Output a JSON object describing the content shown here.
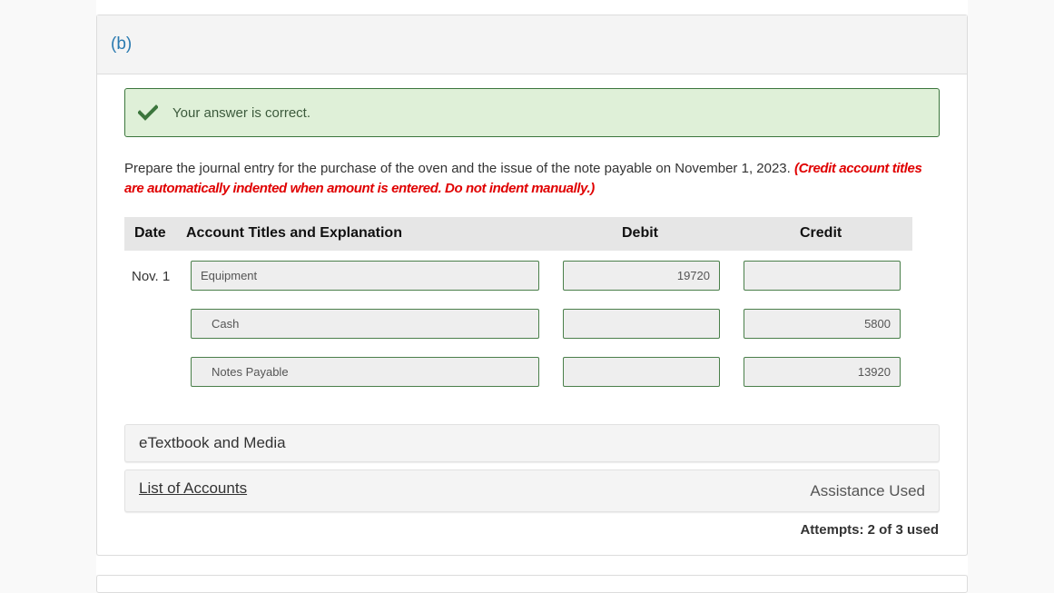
{
  "part": {
    "label": "(b)"
  },
  "feedback": {
    "icon": "checkmark-icon",
    "message": "Your answer is correct.",
    "color": "#3c763d",
    "background": "#dff0d8"
  },
  "instructions": {
    "text": "Prepare the journal entry for the purchase of the oven and the issue of the note payable on November 1, 2023.",
    "note": "(Credit account titles are automatically indented when amount is entered. Do not indent manually.)",
    "note_color": "#e00000"
  },
  "journal": {
    "headers": {
      "date": "Date",
      "account": "Account Titles and Explanation",
      "debit": "Debit",
      "credit": "Credit"
    },
    "rows": [
      {
        "date": "Nov. 1",
        "account": "Equipment",
        "debit": "19720",
        "credit": ""
      },
      {
        "date": "",
        "account": "Cash",
        "debit": "",
        "credit": "5800"
      },
      {
        "date": "",
        "account": "Notes Payable",
        "debit": "",
        "credit": "13920"
      }
    ]
  },
  "resources": {
    "etextbook_label": "eTextbook and Media",
    "list_of_accounts_label": "List of Accounts",
    "assistance_label": "Assistance Used"
  },
  "attempts": {
    "text": "Attempts: 2 of 3 used"
  }
}
